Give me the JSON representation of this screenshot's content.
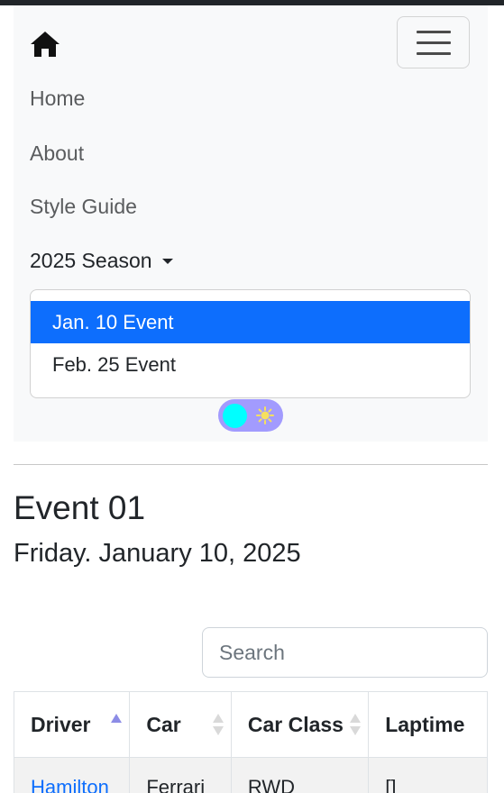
{
  "navbar": {
    "home_icon": "house-icon",
    "toggler_icon": "hamburger-icon",
    "links": [
      "Home",
      "About",
      "Style Guide"
    ],
    "season_dropdown": {
      "label": "2025 Season",
      "items": [
        {
          "label": "Jan. 10 Event",
          "active": true
        },
        {
          "label": "Feb. 25 Event",
          "active": false
        }
      ]
    },
    "theme_toggle": {
      "knob_color": "#00ffff",
      "track_color": "#a29bfe",
      "icon": "sun-icon"
    }
  },
  "event": {
    "title": "Event 01",
    "date": "Friday. January 10, 2025"
  },
  "search": {
    "placeholder": "Search",
    "value": ""
  },
  "table": {
    "columns": [
      {
        "label": "Driver",
        "sort": "ascending"
      },
      {
        "label": "Car",
        "sort": "none"
      },
      {
        "label": "Car Class",
        "sort": "none"
      },
      {
        "label": "Laptime",
        "sort": "none"
      }
    ],
    "rows": [
      {
        "driver": "Hamilton",
        "car": "Ferrari",
        "car_class": "RWD",
        "laptime": "[]"
      }
    ]
  },
  "colors": {
    "accent": "#0d6efd",
    "nav_bg": "#f8f9fa"
  }
}
